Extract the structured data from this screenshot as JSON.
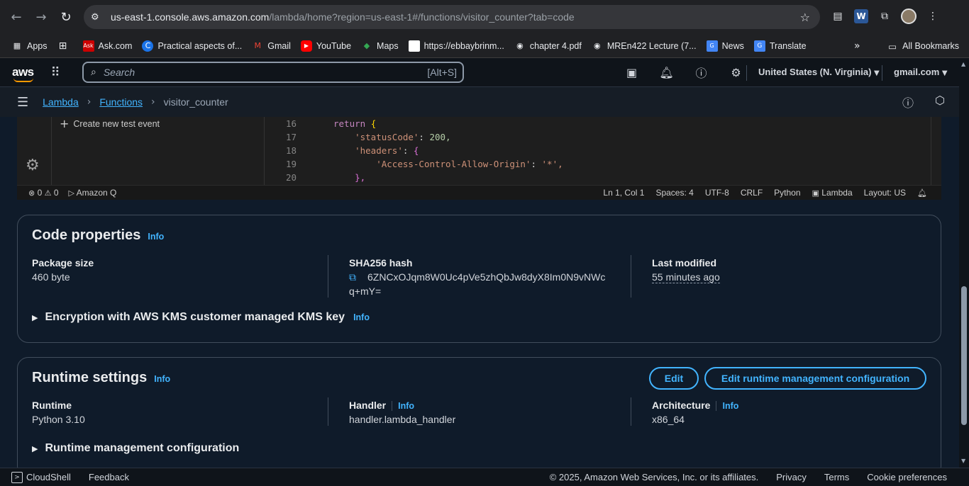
{
  "browser": {
    "url_host": "us-east-1.console.aws.amazon.com",
    "url_path": "/lambda/home?region=us-east-1#/functions/visitor_counter?tab=code"
  },
  "bookmarks": {
    "items": [
      "Apps",
      "Ask.com",
      "Practical aspects of...",
      "Gmail",
      "YouTube",
      "Maps",
      "https://ebbaybrinm...",
      "chapter 4.pdf",
      "MREn422 Lecture (7...",
      "News",
      "Translate"
    ],
    "all_bookmarks": "All Bookmarks"
  },
  "aws_nav": {
    "logo": "aws",
    "search_placeholder": "Search",
    "search_shortcut": "[Alt+S]",
    "region": "United States (N. Virginia)",
    "account": "gmail.com"
  },
  "breadcrumb": {
    "items": [
      "Lambda",
      "Functions"
    ],
    "current": "visitor_counter"
  },
  "editor": {
    "create_test_event": "Create new test event",
    "lines": [
      {
        "n": "16",
        "indent": "",
        "text": "return {"
      },
      {
        "n": "17",
        "indent": "    ",
        "key": "'statusCode'",
        "value": "200,"
      },
      {
        "n": "18",
        "indent": "    ",
        "key": "'headers'",
        "value": "{"
      },
      {
        "n": "19",
        "indent": "        ",
        "key": "'Access-Control-Allow-Origin'",
        "value": "'*',"
      },
      {
        "n": "20",
        "indent": "    ",
        "text": "},"
      }
    ],
    "status": {
      "errors": "0",
      "warnings": "0",
      "amazon_q": "Amazon Q",
      "position": "Ln 1, Col 1",
      "spaces": "Spaces: 4",
      "encoding": "UTF-8",
      "eol": "CRLF",
      "language": "Python",
      "lambda": "Lambda",
      "layout": "Layout: US"
    }
  },
  "code_properties": {
    "title": "Code properties",
    "info": "Info",
    "package_size_label": "Package size",
    "package_size_value": "460 byte",
    "sha_label": "SHA256 hash",
    "sha_value_line1": "6ZNCxOJqm8W0Uc4pVe5zhQbJw8dyX8Im0N9vNWc",
    "sha_value_line2": "q+mY=",
    "last_modified_label": "Last modified",
    "last_modified_value": "55 minutes ago",
    "encryption": "Encryption with AWS KMS customer managed KMS key",
    "encryption_info": "Info"
  },
  "runtime_settings": {
    "title": "Runtime settings",
    "info": "Info",
    "edit_button": "Edit",
    "edit_runtime_button": "Edit runtime management configuration",
    "runtime_label": "Runtime",
    "runtime_value": "Python 3.10",
    "handler_label": "Handler",
    "handler_info": "Info",
    "handler_value": "handler.lambda_handler",
    "architecture_label": "Architecture",
    "architecture_info": "Info",
    "architecture_value": "x86_64",
    "runtime_mgmt": "Runtime management configuration"
  },
  "footer": {
    "cloudshell": "CloudShell",
    "feedback": "Feedback",
    "copyright": "© 2025, Amazon Web Services, Inc. or its affiliates.",
    "privacy": "Privacy",
    "terms": "Terms",
    "cookie": "Cookie preferences"
  }
}
